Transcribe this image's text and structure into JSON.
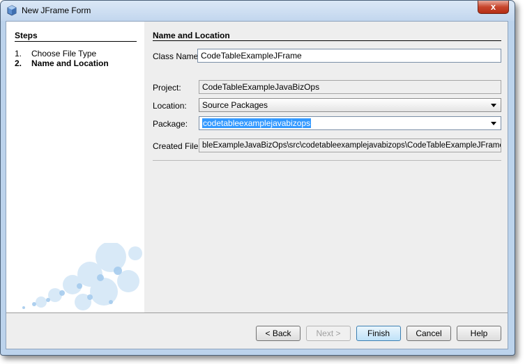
{
  "window": {
    "title": "New JFrame Form",
    "close_symbol": "x"
  },
  "steps": {
    "title": "Steps",
    "items": [
      {
        "num": "1.",
        "label": "Choose File Type"
      },
      {
        "num": "2.",
        "label": "Name and Location"
      }
    ]
  },
  "main": {
    "title": "Name and Location",
    "class_name": {
      "label": "Class Name:",
      "value": "CodeTableExampleJFrame"
    },
    "project": {
      "label": "Project:",
      "value": "CodeTableExampleJavaBizOps"
    },
    "location": {
      "label": "Location:",
      "value": "Source Packages"
    },
    "package": {
      "label": "Package:",
      "value": "codetableexamplejavabizops"
    },
    "created_file": {
      "label": "Created File:",
      "value": "bleExampleJavaBizOps\\src\\codetableexamplejavabizops\\CodeTableExampleJFrame.java"
    }
  },
  "buttons": {
    "back": "< Back",
    "next": "Next >",
    "finish": "Finish",
    "cancel": "Cancel",
    "help": "Help"
  },
  "colors": {
    "selection": "#3399ff",
    "titlebar": "#c2d6ee",
    "close": "#c7452c"
  }
}
